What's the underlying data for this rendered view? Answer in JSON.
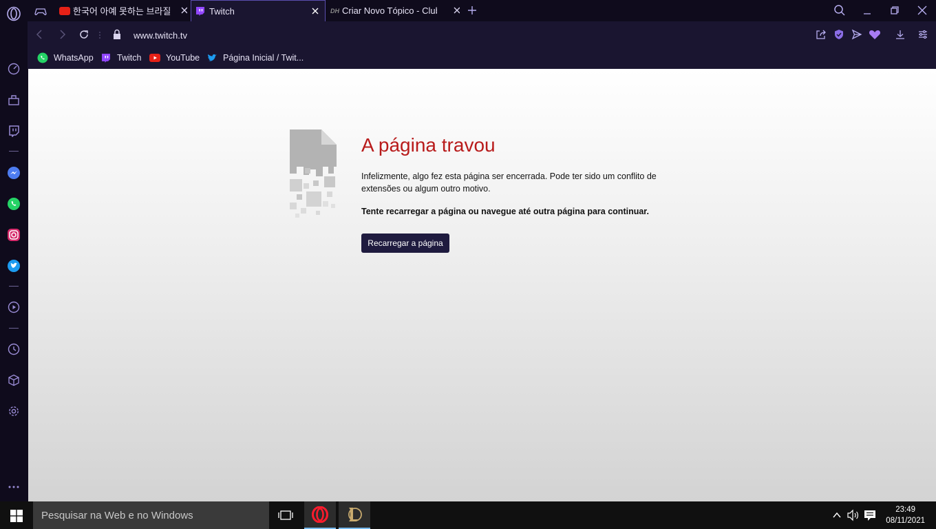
{
  "tabs": [
    {
      "title": "한국어 아예 못하는 브라질",
      "active": false
    },
    {
      "title": "Twitch",
      "active": true
    },
    {
      "title": "Criar Novo Tópico - Clube",
      "active": false
    }
  ],
  "address": {
    "url": "www.twitch.tv"
  },
  "bookmarks": [
    {
      "label": "WhatsApp"
    },
    {
      "label": "Twitch"
    },
    {
      "label": "YouTube"
    },
    {
      "label": "Página Inicial / Twit..."
    }
  ],
  "crash": {
    "title": "A página travou",
    "description": "Infelizmente, algo fez esta página ser encerrada. Pode ter sido um conflito de extensões ou algum outro motivo.",
    "hint": "Tente recarregar a página ou navegue até outra página para continuar.",
    "reload_label": "Recarregar a página"
  },
  "taskbar": {
    "search_placeholder": "Pesquisar na Web e no Windows",
    "time": "23:49",
    "date": "08/11/2021"
  },
  "colors": {
    "accent": "#9a8cd6",
    "crash_title": "#b81b1b",
    "button": "#1f1b3f"
  }
}
